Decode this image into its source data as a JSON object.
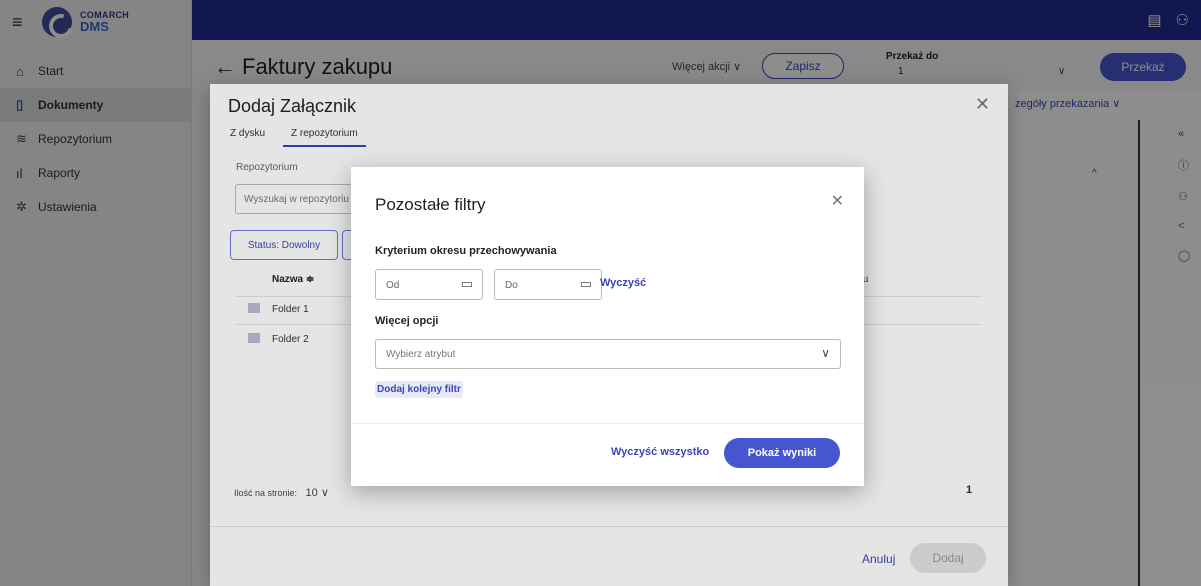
{
  "brand": {
    "top": "COMARCH",
    "bottom": "DMS"
  },
  "sidebar": {
    "items": [
      {
        "label": "Start",
        "icon": "home-icon",
        "glyph": "⌂"
      },
      {
        "label": "Dokumenty",
        "icon": "document-icon",
        "glyph": "▯"
      },
      {
        "label": "Repozytorium",
        "icon": "layers-icon",
        "glyph": "≋"
      },
      {
        "label": "Raporty",
        "icon": "chart-icon",
        "glyph": "ıl"
      },
      {
        "label": "Ustawienia",
        "icon": "gear-icon",
        "glyph": "✲"
      }
    ],
    "active_index": 1
  },
  "header": {
    "title": "Faktury zakupu",
    "more_actions": "Więcej akcji ∨",
    "save": "Zapisz",
    "pass_to_label": "Przekaż do",
    "pass_to_value": "1",
    "pass_button": "Przekaż",
    "details_link": "zegóły przekazania ∨"
  },
  "attach_dialog": {
    "title": "Dodaj Załącznik",
    "tabs": [
      "Z dysku",
      "Z repozytorium"
    ],
    "repo_label": "Repozytorium",
    "search_placeholder": "Wyszukaj w repozytoriu",
    "status_filter": "Status: Dowolny",
    "col_name": "Nazwa ≑",
    "col_right": "tu",
    "folders": [
      "Folder 1",
      "Folder 2"
    ],
    "per_page_label": "Ilość na stronie:",
    "per_page_value": "10 ∨",
    "page": "1",
    "cancel": "Anuluj",
    "add": "Dodaj"
  },
  "filters_dialog": {
    "title": "Pozostałe filtry",
    "criterion_label": "Kryterium okresu przechowywania",
    "from_placeholder": "Od",
    "to_placeholder": "Do",
    "clear": "Wyczyść",
    "more_options_label": "Więcej opcji",
    "attribute_placeholder": "Wybierz atrybut",
    "add_filter": "Dodaj kolejny filtr",
    "clear_all": "Wyczyść wszystko",
    "show_results": "Pokaż wyniki"
  },
  "colors": {
    "topbar": "#242b8f",
    "primary": "#4656d0",
    "link": "#3946b7"
  }
}
